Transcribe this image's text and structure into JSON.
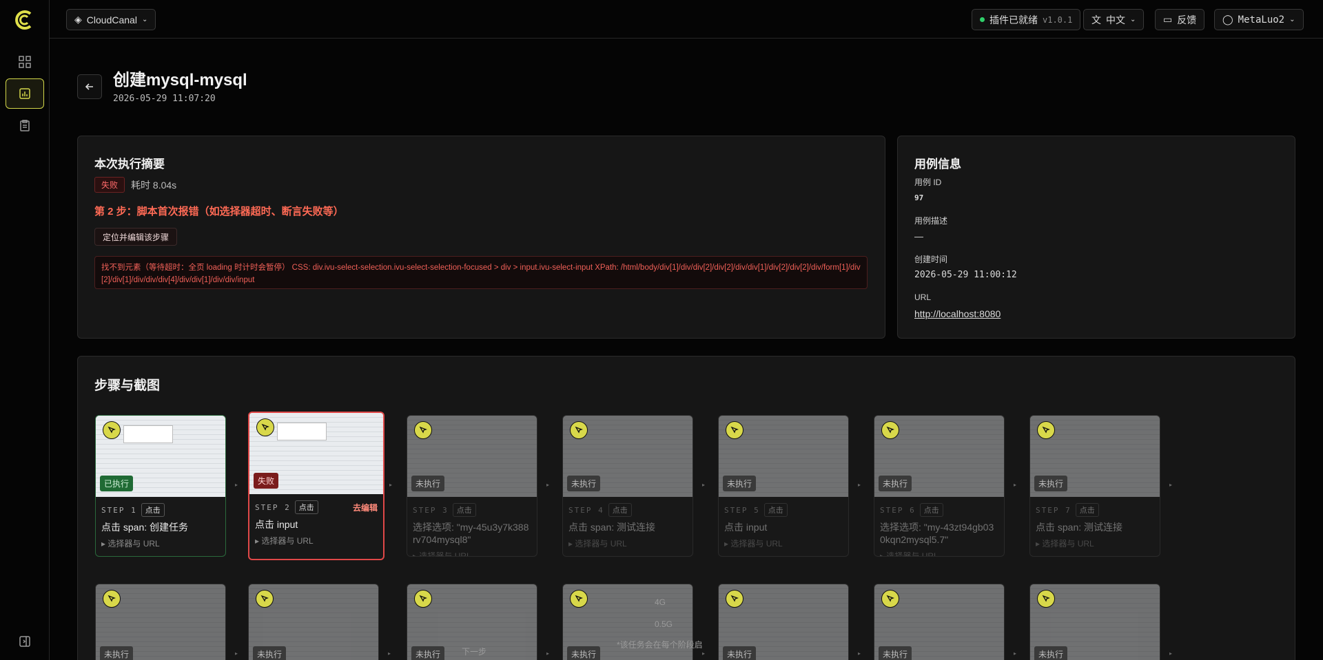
{
  "topbar": {
    "workspace": "CloudCanal",
    "plugin_status": "插件已就绪",
    "plugin_version": "v1.0.1",
    "language": "中文",
    "feedback": "反馈",
    "user": "MetaLuo2"
  },
  "page": {
    "title": "创建mysql-mysql",
    "timestamp": "2026-05-29 11:07:20"
  },
  "summary": {
    "title": "本次执行摘要",
    "status": "失败",
    "duration": "耗时 8.04s",
    "error_title": "第 2 步：脚本首次报错（如选择器超时、断言失败等）",
    "locate_button": "定位并编辑该步骤",
    "error_detail": "找不到元素（等待超时：全页 loading 时计时会暂停） CSS: div.ivu-select-selection.ivu-select-selection-focused > div > input.ivu-select-input XPath: /html/body/div[1]/div/div[2]/div[2]/div/div[1]/div[2]/div[2]/div/form[1]/div[2]/div[1]/div/div/div[4]/div/div[1]/div/div/input"
  },
  "case_info": {
    "title": "用例信息",
    "id_label": "用例 ID",
    "id_value": "97",
    "desc_label": "用例描述",
    "desc_value": "—",
    "created_label": "创建时间",
    "created_value": "2026-05-29 11:00:12",
    "url_label": "URL",
    "url_value": "http://localhost:8080"
  },
  "steps_section": {
    "title": "步骤与截图",
    "selector_toggle": "▸ 选择器与 URL",
    "edit_label": "去编辑"
  },
  "steps": [
    {
      "step": "STEP 1",
      "action": "点击",
      "desc": "点击 span: 创建任务",
      "state": "已执行"
    },
    {
      "step": "STEP 2",
      "action": "点击",
      "desc": "点击 input",
      "state": "失败"
    },
    {
      "step": "STEP 3",
      "action": "点击",
      "desc": "选择选项: \"my-45u3y7k388rv704mysql8\"",
      "state": "未执行"
    },
    {
      "step": "STEP 4",
      "action": "点击",
      "desc": "点击 span: 测试连接",
      "state": "未执行"
    },
    {
      "step": "STEP 5",
      "action": "点击",
      "desc": "点击 input",
      "state": "未执行"
    },
    {
      "step": "STEP 6",
      "action": "点击",
      "desc": "选择选项: \"my-43zt94gb030kqn2mysql5.7\"",
      "state": "未执行"
    },
    {
      "step": "STEP 7",
      "action": "点击",
      "desc": "点击 span: 测试连接",
      "state": "未执行"
    }
  ],
  "row2": {
    "state": "未执行",
    "labels": [
      "4G",
      "0.5G",
      "下一步",
      "*该任务会在每个阶段启"
    ]
  }
}
